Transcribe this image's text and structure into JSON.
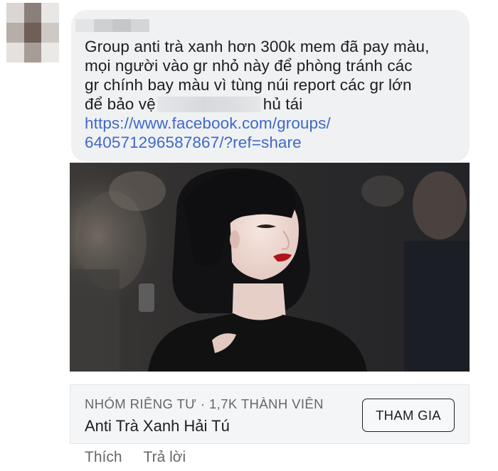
{
  "comment": {
    "lines": [
      "Group anti trà xanh hơn 300k mem đã pay màu,",
      "mọi người vào gr nhỏ này để phòng tránh các",
      "gr chính bay màu vì tùng núi report các gr lớn"
    ],
    "line4_before_redaction": "để bảo vệ",
    "line4_after_redaction": "hủ tái",
    "link_line1": "https://www.facebook.com/groups/",
    "link_line2": "640571296587867/?ref=share"
  },
  "link_preview": {
    "meta": "NHÓM RIÊNG TƯ · 1,7K THÀNH VIÊN",
    "group_name": "Anti Trà Xanh Hải Tú",
    "join_label": "THAM GIA"
  },
  "actions": {
    "like": "Thích",
    "reply": "Trả lời"
  },
  "colors": {
    "bubble_bg": "#eff1f3",
    "link": "#3f69c8",
    "secondary_text": "#65676b",
    "lips": "#b0141c"
  }
}
